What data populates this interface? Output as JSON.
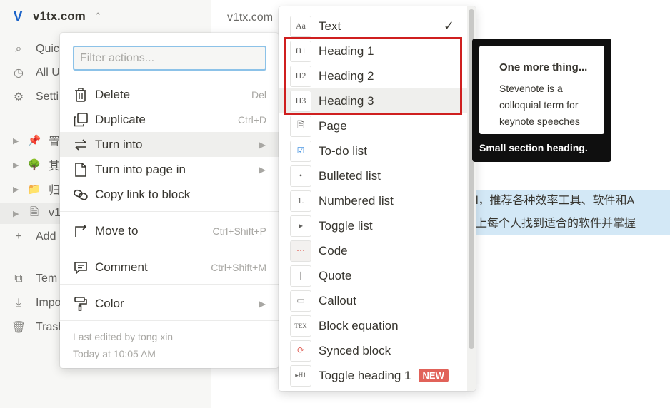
{
  "workspace": {
    "name": "v1tx.com",
    "logo": "V",
    "switch_icon": "⌃"
  },
  "sidebar": {
    "nav": [
      {
        "icon": "search-icon",
        "glyph": "⌕",
        "label": "Quic"
      },
      {
        "icon": "clock-icon",
        "glyph": "◷",
        "label": "All U"
      },
      {
        "icon": "gear-icon",
        "glyph": "⚙",
        "label": "Setti"
      }
    ],
    "pages": [
      {
        "icon": "pin-icon",
        "glyph": "📌",
        "label": "置"
      },
      {
        "icon": "tree-icon",
        "glyph": "🌳",
        "label": "其"
      },
      {
        "icon": "folder-icon",
        "glyph": "📁",
        "label": "归"
      },
      {
        "icon": "page-icon",
        "glyph": "🗎",
        "label": "v1"
      }
    ],
    "add_label": "Add",
    "bottom": [
      {
        "icon": "templates-icon",
        "glyph": "⧉",
        "label": "Tem"
      },
      {
        "icon": "import-icon",
        "glyph": "⤓",
        "label": "Impo"
      },
      {
        "icon": "trash-icon",
        "glyph": "🗑",
        "label": "Trash"
      }
    ]
  },
  "page": {
    "breadcrumb": "v1tx.com",
    "highlight_line1": "l，推荐各种效率工具、软件和A",
    "highlight_line2": "上每个人找到适合的软件并掌握"
  },
  "action_menu": {
    "filter_placeholder": "Filter actions...",
    "items": {
      "delete": {
        "label": "Delete",
        "shortcut": "Del"
      },
      "duplicate": {
        "label": "Duplicate",
        "shortcut": "Ctrl+D"
      },
      "turn_into": {
        "label": "Turn into"
      },
      "turn_into_page": {
        "label": "Turn into page in"
      },
      "copy_link": {
        "label": "Copy link to block"
      },
      "move_to": {
        "label": "Move to",
        "shortcut": "Ctrl+Shift+P"
      },
      "comment": {
        "label": "Comment",
        "shortcut": "Ctrl+Shift+M"
      },
      "color": {
        "label": "Color"
      }
    },
    "last_edited": "Last edited by tong xin",
    "edited_time": "Today at 10:05 AM"
  },
  "turn_into_menu": {
    "items": [
      {
        "label": "Text",
        "thumb": "Aa",
        "checked": true
      },
      {
        "label": "Heading 1",
        "thumb": "H1"
      },
      {
        "label": "Heading 2",
        "thumb": "H2"
      },
      {
        "label": "Heading 3",
        "thumb": "H3"
      },
      {
        "label": "Page",
        "thumb": "🗎"
      },
      {
        "label": "To-do list",
        "thumb": "☑"
      },
      {
        "label": "Bulleted list",
        "thumb": "•"
      },
      {
        "label": "Numbered list",
        "thumb": "1."
      },
      {
        "label": "Toggle list",
        "thumb": "▸"
      },
      {
        "label": "Code",
        "thumb": "⋯"
      },
      {
        "label": "Quote",
        "thumb": "❘"
      },
      {
        "label": "Callout",
        "thumb": "▭"
      },
      {
        "label": "Block equation",
        "thumb": "TEX"
      },
      {
        "label": "Synced block",
        "thumb": "⟳"
      },
      {
        "label": "Toggle heading 1",
        "thumb": "▸H1",
        "badge": "NEW"
      }
    ]
  },
  "tooltip": {
    "title": "One more thing...",
    "body": "Stevenote is a colloquial term for keynote speeches",
    "caption": "Small section heading."
  },
  "colors": {
    "highlight_box": "#cf1f1f",
    "accent": "#1d64c8",
    "new_badge": "#e16259"
  }
}
